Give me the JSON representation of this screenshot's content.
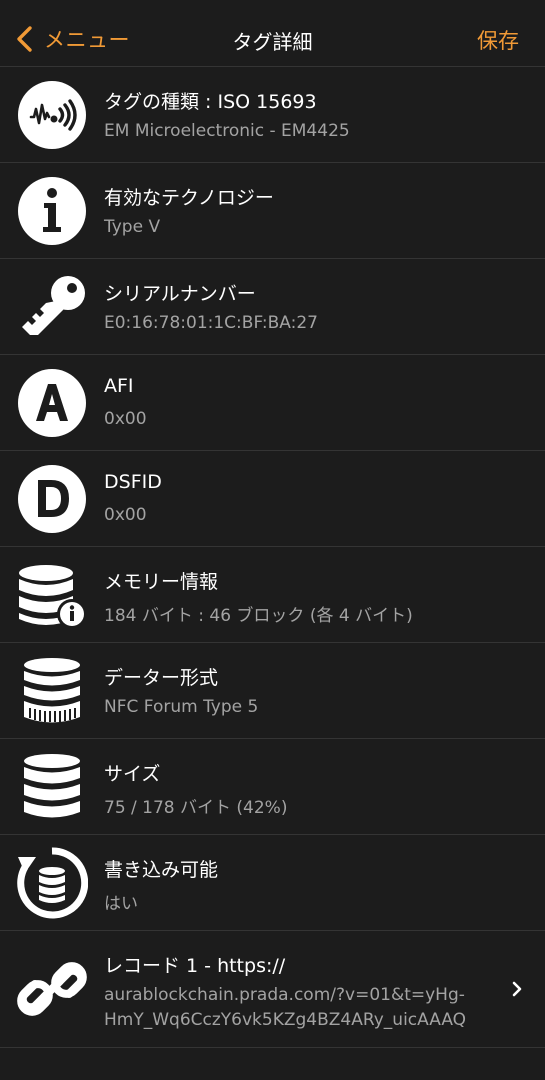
{
  "nav": {
    "back_label": "メニュー",
    "title": "タグ詳細",
    "save_label": "保存"
  },
  "colors": {
    "accent": "#f19a36",
    "background": "#1c1c1c",
    "subtext": "#a3a3a3",
    "separator": "#343434"
  },
  "rows": [
    {
      "icon": "nfc-signal-icon",
      "title": "タグの種類 : ISO 15693",
      "value": "EM Microelectronic - EM4425"
    },
    {
      "icon": "info-icon",
      "title": "有効なテクノロジー",
      "value": "Type V"
    },
    {
      "icon": "key-icon",
      "title": "シリアルナンバー",
      "value": "E0:16:78:01:1C:BF:BA:27"
    },
    {
      "icon": "letter-a-icon",
      "title": "AFI",
      "value": "0x00"
    },
    {
      "icon": "letter-d-icon",
      "title": "DSFID",
      "value": "0x00"
    },
    {
      "icon": "database-info-icon",
      "title": "メモリー情報",
      "value": "184 バイト : 46 ブロック (各 4 バイト)"
    },
    {
      "icon": "database-format-icon",
      "title": "データー形式",
      "value": "NFC Forum Type 5"
    },
    {
      "icon": "database-icon",
      "title": "サイズ",
      "value": "75 / 178 バイト (42%)"
    },
    {
      "icon": "database-refresh-icon",
      "title": "書き込み可能",
      "value": "はい"
    },
    {
      "icon": "link-icon",
      "title": "レコード 1 - https://",
      "value_line1": "aurablockchain.prada.com/?v=01&t=yHg-",
      "value_line2": "HmY_Wq6CczY6vk5KZg4BZ4ARy_uicAAAQ",
      "disclosure": "chevron-right-icon"
    }
  ]
}
